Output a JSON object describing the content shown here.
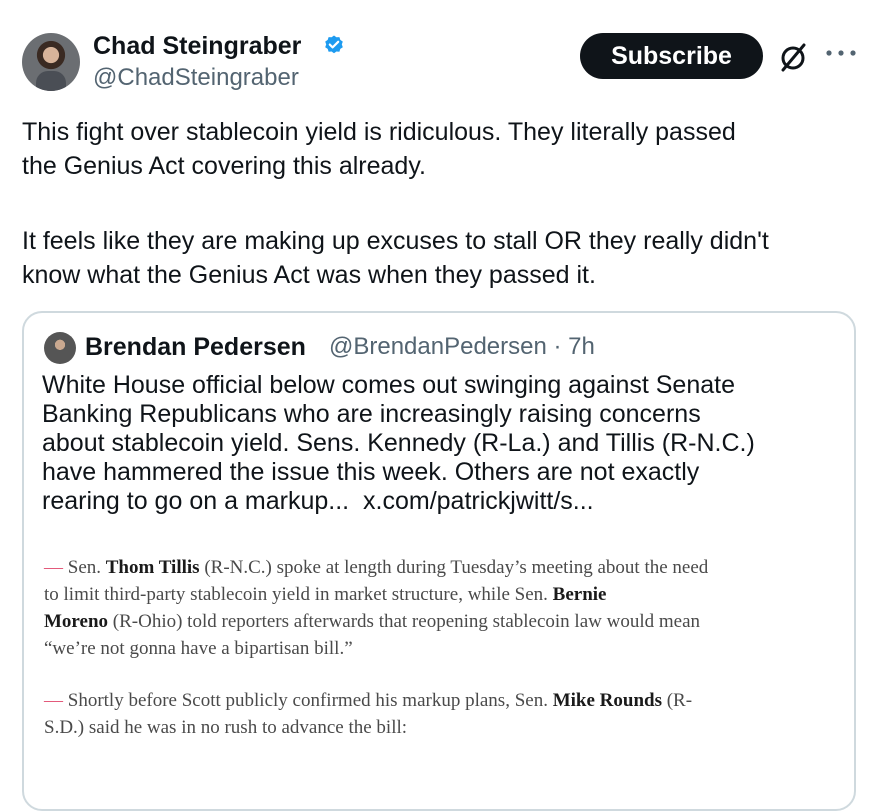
{
  "author": {
    "name": "Chad Steingraber",
    "handle": "@ChadSteingraber",
    "subscribe_label": "Subscribe",
    "more_label": "···"
  },
  "tweet": {
    "lines": [
      "This fight over stablecoin yield is ridiculous.  They literally passed",
      "the Genius Act covering this already.",
      "It feels like they are making up excuses to stall OR they really didn't",
      "know what the Genius Act was when they passed it."
    ]
  },
  "quote": {
    "name": "Brendan Pedersen",
    "handle_time": "@BrendanPedersen · 7h",
    "lines": [
      "White House official below comes out swinging against Senate",
      "Banking Republicans who are increasingly raising concerns",
      "about stablecoin yield. Sens. Kennedy (R-La.) and Tillis (R-N.C.)",
      "have hammered the issue this week. Others are not exactly"
    ],
    "last_line_text": "rearing to go on a markup...",
    "link": "x.com/patrickjwitt/s..."
  },
  "article": {
    "dash": "—",
    "p1": {
      "l1_a": " Sen. ",
      "l1_b": "Thom Tillis",
      "l1_c": " (R-N.C.) spoke at length during Tuesday’s meeting about the need",
      "l2_a": "to limit third-party stablecoin yield in market structure, while Sen. ",
      "l2_b": "Bernie",
      "l3_a": "Moreno",
      "l3_b": " (R-Ohio) told reporters afterwards that reopening stablecoin law would mean",
      "l4": "“we’re not gonna have a bipartisan bill.”"
    },
    "p2": {
      "l1_a": " Shortly before Scott publicly confirmed his markup plans, Sen. ",
      "l1_b": "Mike Rounds",
      "l1_c": " (R-",
      "l2": "S.D.) said he was in no rush to advance the bill:"
    }
  },
  "colors": {
    "verified": "#1d9bf0",
    "accent_dash": "#e35a7b",
    "button_bg": "#0f1419"
  }
}
